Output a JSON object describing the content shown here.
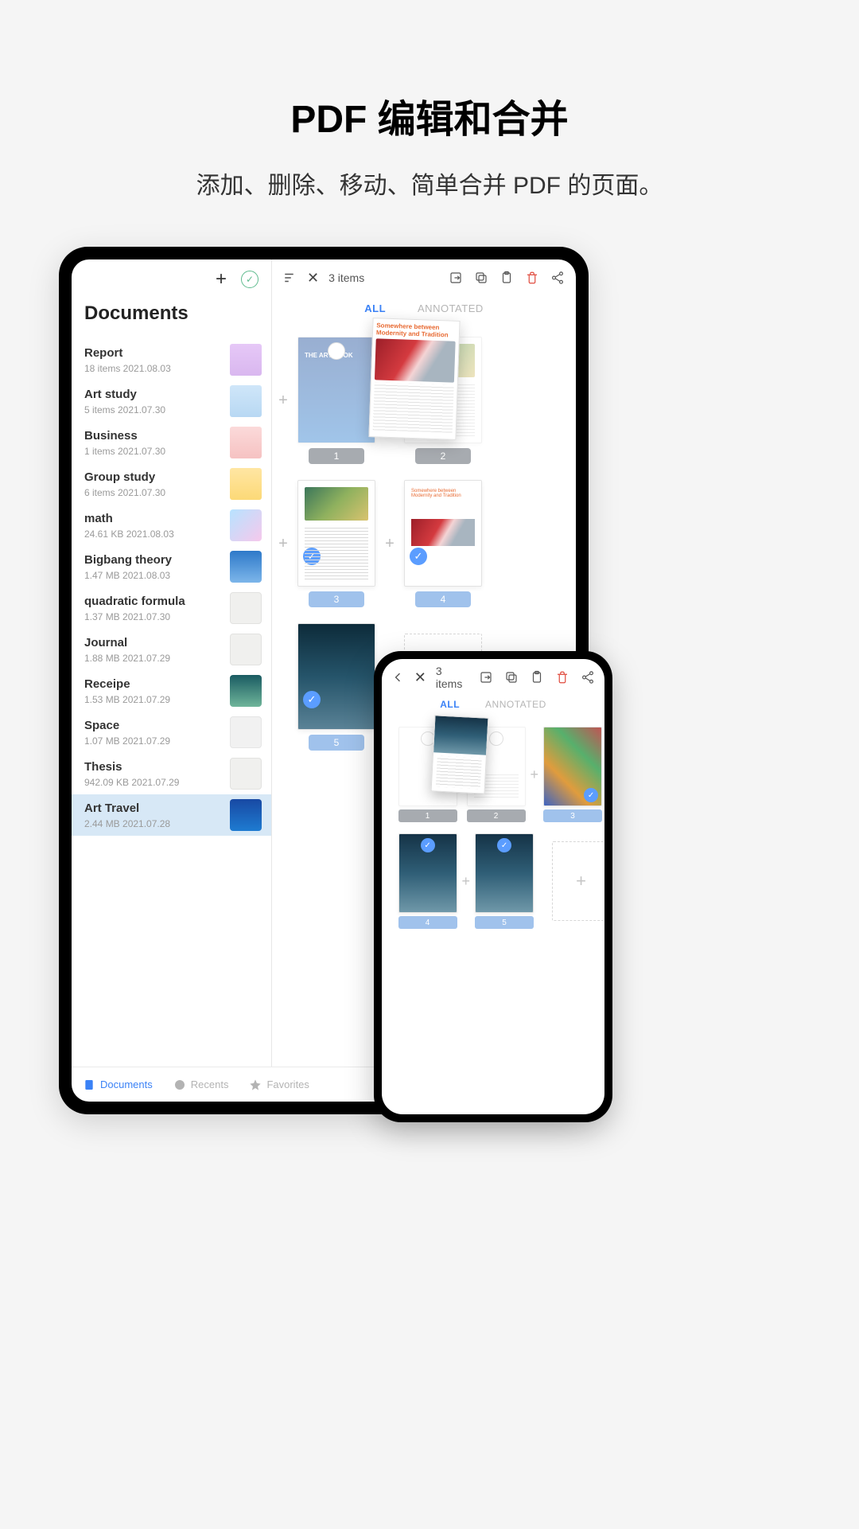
{
  "hero": {
    "title": "PDF 编辑和合并",
    "subtitle": "添加、删除、移动、简单合并 PDF 的页面。"
  },
  "tablet": {
    "sidebar": {
      "title": "Documents",
      "docs": [
        {
          "name": "Report",
          "meta": "18 items   2021.08.03",
          "thumb_class": "folder-purple"
        },
        {
          "name": "Art study",
          "meta": "5 items   2021.07.30",
          "thumb_class": "folder-blue"
        },
        {
          "name": "Business",
          "meta": "1 items   2021.07.30",
          "thumb_class": "folder-pink"
        },
        {
          "name": "Group study",
          "meta": "6 items   2021.07.30",
          "thumb_class": "folder-yellow"
        },
        {
          "name": "math",
          "meta": "24.61 KB   2021.08.03",
          "thumb_class": "thumb-gradient"
        },
        {
          "name": "Bigbang theory",
          "meta": "1.47 MB   2021.08.03",
          "thumb_class": "thumb-sky"
        },
        {
          "name": "quadratic formula",
          "meta": "1.37 MB   2021.07.30",
          "thumb_class": "thumb-paper"
        },
        {
          "name": "Journal",
          "meta": "1.88 MB   2021.07.29",
          "thumb_class": "thumb-paper"
        },
        {
          "name": "Receipe",
          "meta": "1.53 MB   2021.07.29",
          "thumb_class": "thumb-mag"
        },
        {
          "name": "Space",
          "meta": "1.07 MB   2021.07.29",
          "thumb_class": "thumb-news"
        },
        {
          "name": "Thesis",
          "meta": "942.09 KB   2021.07.29",
          "thumb_class": "thumb-paper"
        },
        {
          "name": "Art Travel",
          "meta": "2.44 MB    2021.07.28",
          "thumb_class": "thumb-art",
          "selected": true
        }
      ]
    },
    "content": {
      "item_count": "3 items",
      "tabs": {
        "all": "ALL",
        "annotated": "ANNOTATED"
      },
      "floating_hdr": "Somewhere between Modernity and Tradition",
      "pages": {
        "r1": [
          {
            "n": "1"
          },
          {
            "n": "2"
          }
        ],
        "r2": [
          {
            "n": "3",
            "checked": true
          },
          {
            "n": "4",
            "checked": true
          }
        ],
        "r3": [
          {
            "n": "5",
            "checked": true
          }
        ]
      }
    },
    "nav": {
      "documents": "Documents",
      "recents": "Recents",
      "favorites": "Favorites"
    }
  },
  "phone": {
    "item_count": "3 items",
    "tabs": {
      "all": "ALL",
      "annotated": "ANNOTATED"
    },
    "pages": {
      "r1": [
        {
          "n": "1"
        },
        {
          "n": "2"
        },
        {
          "n": "3",
          "checked": true
        }
      ],
      "r2": [
        {
          "n": "4",
          "checked": true
        },
        {
          "n": "5",
          "checked": true
        }
      ]
    },
    "add": "+"
  }
}
